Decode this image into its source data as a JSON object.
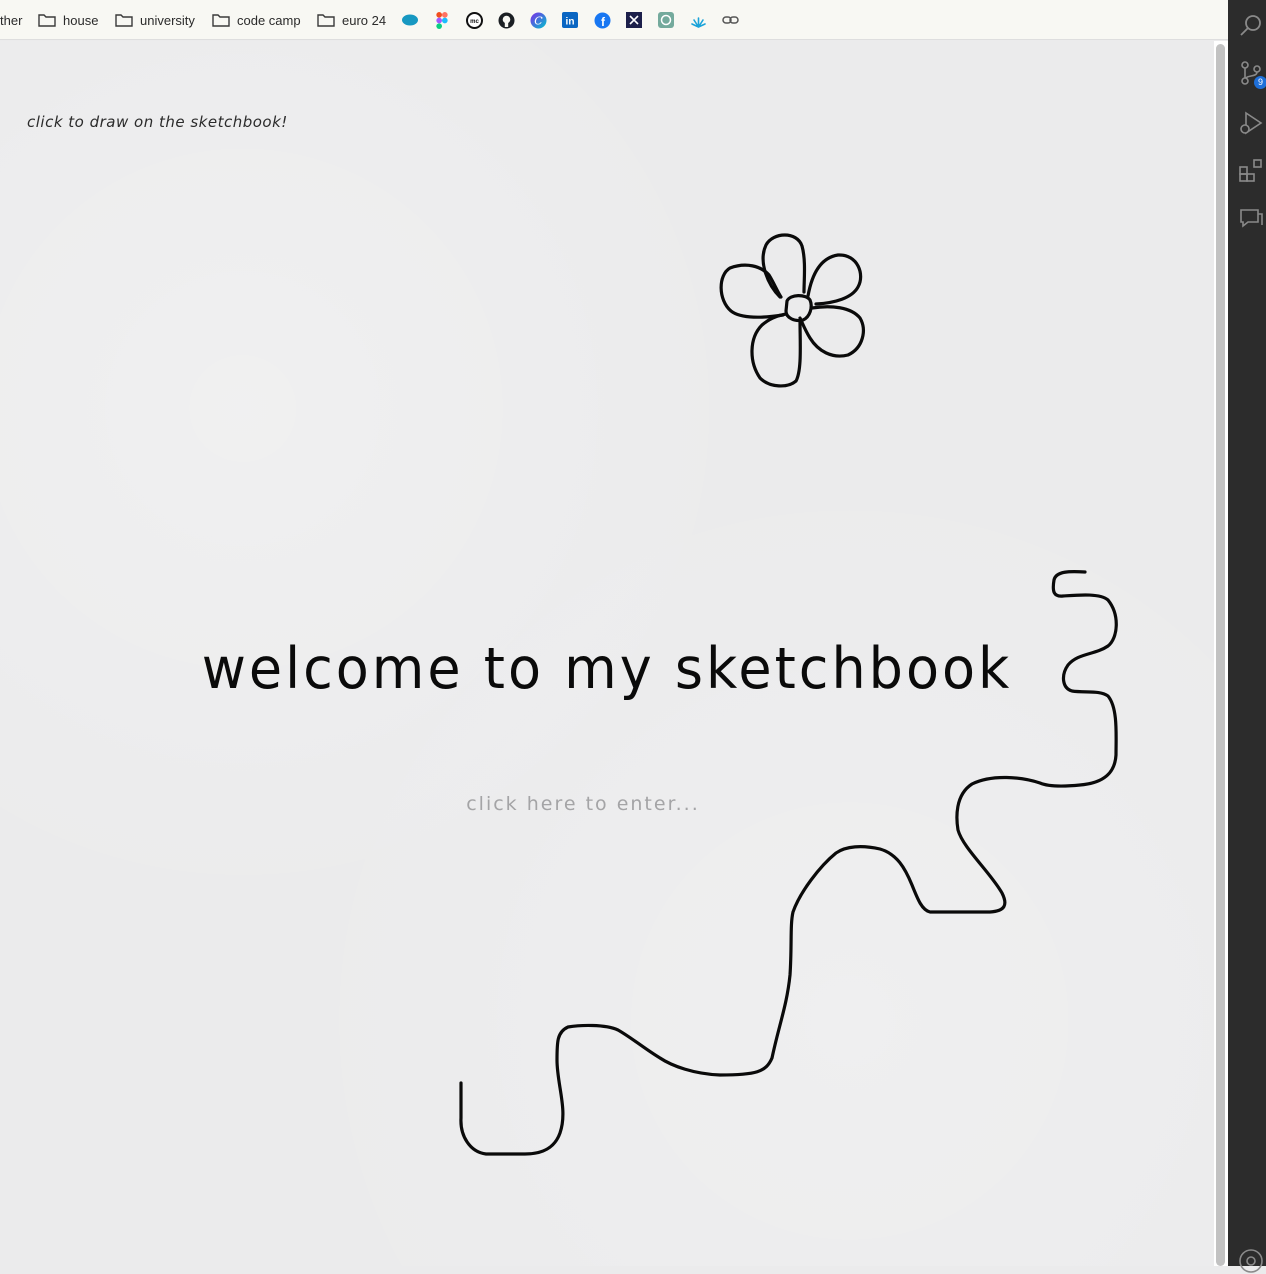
{
  "bookmarks": {
    "truncated": "ther",
    "folders": [
      "house",
      "university",
      "code camp",
      "euro 24"
    ],
    "favicons": [
      "salesforce-icon",
      "figma-icon",
      "mc-icon",
      "github-icon",
      "canva-icon",
      "linkedin-icon",
      "facebook-icon",
      "x-dark-icon",
      "chatgpt-icon",
      "sparkle-icon",
      "link-icon"
    ]
  },
  "page": {
    "hint": "click to draw on the sketchbook!",
    "title": "welcome to my sketchbook",
    "enter": "click here to enter..."
  },
  "activity_bar": {
    "icons": [
      "search-icon",
      "source-control-icon",
      "run-debug-icon",
      "extensions-icon",
      "chat-icon",
      "account-icon"
    ],
    "source_control_badge": "9"
  },
  "colors": {
    "paper": "#ebebec",
    "ink": "#0a0a0a",
    "enter_text": "#a4a4a6",
    "activity_bar": "#2c2c2c",
    "badge": "#1e6fd9"
  }
}
